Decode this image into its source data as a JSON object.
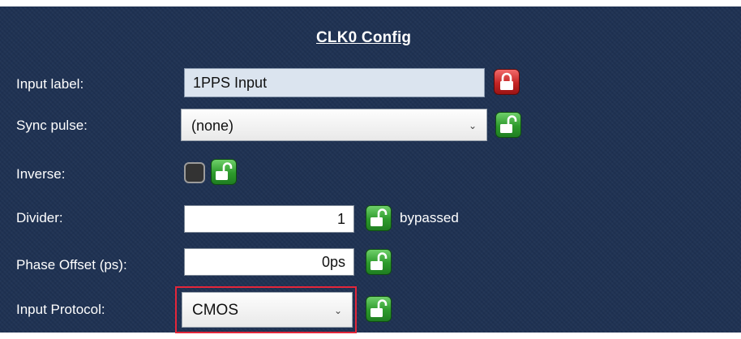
{
  "panel": {
    "title": "CLK0 Config"
  },
  "rows": {
    "input_label": {
      "label": "Input label:",
      "value": "1PPS Input",
      "lock": "locked"
    },
    "sync_pulse": {
      "label": "Sync pulse:",
      "value": "(none)",
      "lock": "unlocked"
    },
    "inverse": {
      "label": "Inverse:",
      "checked": false,
      "lock": "unlocked"
    },
    "divider": {
      "label": "Divider:",
      "value": "1",
      "note": "bypassed",
      "lock": "unlocked"
    },
    "phase_offset": {
      "label": "Phase Offset (ps):",
      "value": "0ps",
      "lock": "unlocked"
    },
    "input_protocol": {
      "label": "Input Protocol:",
      "value": "CMOS",
      "lock": "unlocked",
      "highlighted": true
    }
  },
  "icons": {
    "locked": "lock-closed-icon",
    "unlocked": "lock-open-icon",
    "dropdown": "chevron-down-icon"
  },
  "colors": {
    "panel_bg": "#1f3253",
    "lock_green": "#2d9a2c",
    "lock_red": "#c42525",
    "highlight": "#e3263a"
  }
}
